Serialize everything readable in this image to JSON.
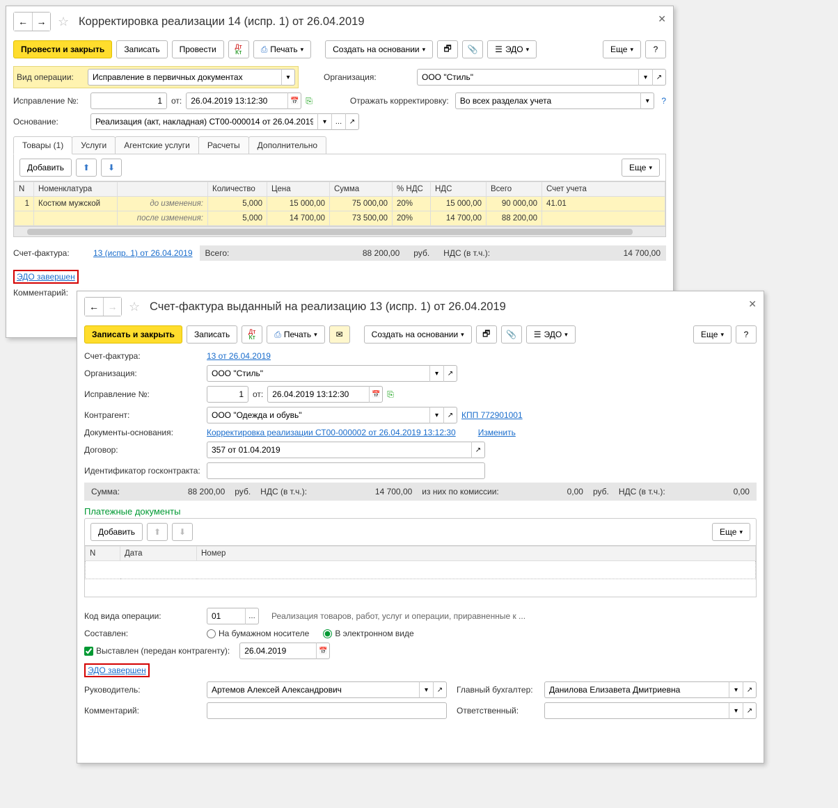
{
  "win1": {
    "title": "Корректировка реализации 14 (испр. 1) от 26.04.2019",
    "toolbar": {
      "post_close": "Провести и закрыть",
      "save": "Записать",
      "post": "Провести",
      "print": "Печать",
      "create_based": "Создать на основании",
      "edo": "ЭДО",
      "more": "Еще",
      "help": "?"
    },
    "form": {
      "op_type_lbl": "Вид операции:",
      "op_type_val": "Исправление в первичных документах",
      "org_lbl": "Организация:",
      "org_val": "ООО \"Стиль\"",
      "corr_no_lbl": "Исправление №:",
      "corr_no_val": "1",
      "date_lbl": "от:",
      "date_val": "26.04.2019 13:12:30",
      "reflect_lbl": "Отражать корректировку:",
      "reflect_val": "Во всех разделах учета",
      "basis_lbl": "Основание:",
      "basis_val": "Реализация (акт, накладная) СТ00-000014 от 26.04.2019"
    },
    "tabs": {
      "goods": "Товары (1)",
      "services": "Услуги",
      "agent": "Агентские услуги",
      "calc": "Расчеты",
      "extra": "Дополнительно"
    },
    "tab_toolbar": {
      "add": "Добавить",
      "more": "Еще"
    },
    "grid": {
      "cols": [
        "N",
        "Номенклатура",
        "",
        "Количество",
        "Цена",
        "Сумма",
        "% НДС",
        "НДС",
        "Всего",
        "Счет учета"
      ],
      "before_lbl": "до изменения:",
      "after_lbl": "после изменения:",
      "row": {
        "n": "1",
        "name": "Костюм мужской",
        "before": {
          "qty": "5,000",
          "price": "15 000,00",
          "sum": "75 000,00",
          "vatp": "20%",
          "vat": "15 000,00",
          "total": "90 000,00",
          "acct": "41.01"
        },
        "after": {
          "qty": "5,000",
          "price": "14 700,00",
          "sum": "73 500,00",
          "vatp": "20%",
          "vat": "14 700,00",
          "total": "88 200,00",
          "acct": ""
        }
      }
    },
    "footer": {
      "sf_lbl": "Счет-фактура:",
      "sf_link": "13 (испр. 1) от 26.04.2019",
      "total_lbl": "Всего:",
      "total_val": "88 200,00",
      "curr": "руб.",
      "vat_lbl": "НДС (в т.ч.):",
      "vat_val": "14 700,00",
      "edo_done": "ЭДО завершен",
      "comment_lbl": "Комментарий:"
    }
  },
  "win2": {
    "title": "Счет-фактура выданный на реализацию 13 (испр. 1) от 26.04.2019",
    "toolbar": {
      "post_close": "Записать и закрыть",
      "save": "Записать",
      "print": "Печать",
      "create_based": "Создать на основании",
      "edo": "ЭДО",
      "more": "Еще",
      "help": "?"
    },
    "form": {
      "sf_lbl": "Счет-фактура:",
      "sf_link": "13 от 26.04.2019",
      "org_lbl": "Организация:",
      "org_val": "ООО \"Стиль\"",
      "corr_no_lbl": "Исправление №:",
      "corr_no_val": "1",
      "date_lbl": "от:",
      "date_val": "26.04.2019 13:12:30",
      "contragent_lbl": "Контрагент:",
      "contragent_val": "ООО \"Одежда и обувь\"",
      "kpp": "КПП 772901001",
      "docs_lbl": "Документы-основания:",
      "docs_link": "Корректировка реализации СТ00-000002 от 26.04.2019 13:12:30",
      "change": "Изменить",
      "contract_lbl": "Договор:",
      "contract_val": "357 от 01.04.2019",
      "goscontract_lbl": "Идентификатор госконтракта:",
      "goscontract_val": ""
    },
    "totals": {
      "sum_lbl": "Сумма:",
      "sum_val": "88 200,00",
      "curr": "руб.",
      "vat_lbl": "НДС (в т.ч.):",
      "vat_val": "14 700,00",
      "commission_lbl": "из них по комиссии:",
      "commission_val": "0,00",
      "curr2": "руб.",
      "vat2_lbl": "НДС (в т.ч.):",
      "vat2_val": "0,00"
    },
    "pay_docs": {
      "title": "Платежные документы",
      "add": "Добавить",
      "more": "Еще",
      "cols": [
        "N",
        "Дата",
        "Номер"
      ]
    },
    "bottom": {
      "op_code_lbl": "Код вида операции:",
      "op_code_val": "01",
      "op_code_desc": "Реализация товаров, работ, услуг и операции, приравненные к ...",
      "composed_lbl": "Составлен:",
      "composed_paper": "На бумажном носителе",
      "composed_electronic": "В электронном виде",
      "issued_lbl": "Выставлен (передан контрагенту):",
      "issued_date": "26.04.2019",
      "edo_done": "ЭДО завершен",
      "head_lbl": "Руководитель:",
      "head_val": "Артемов Алексей Александрович",
      "acct_lbl": "Главный бухгалтер:",
      "acct_val": "Данилова Елизавета Дмитриевна",
      "comment_lbl": "Комментарий:",
      "comment_val": "",
      "resp_lbl": "Ответственный:",
      "resp_val": ""
    }
  }
}
